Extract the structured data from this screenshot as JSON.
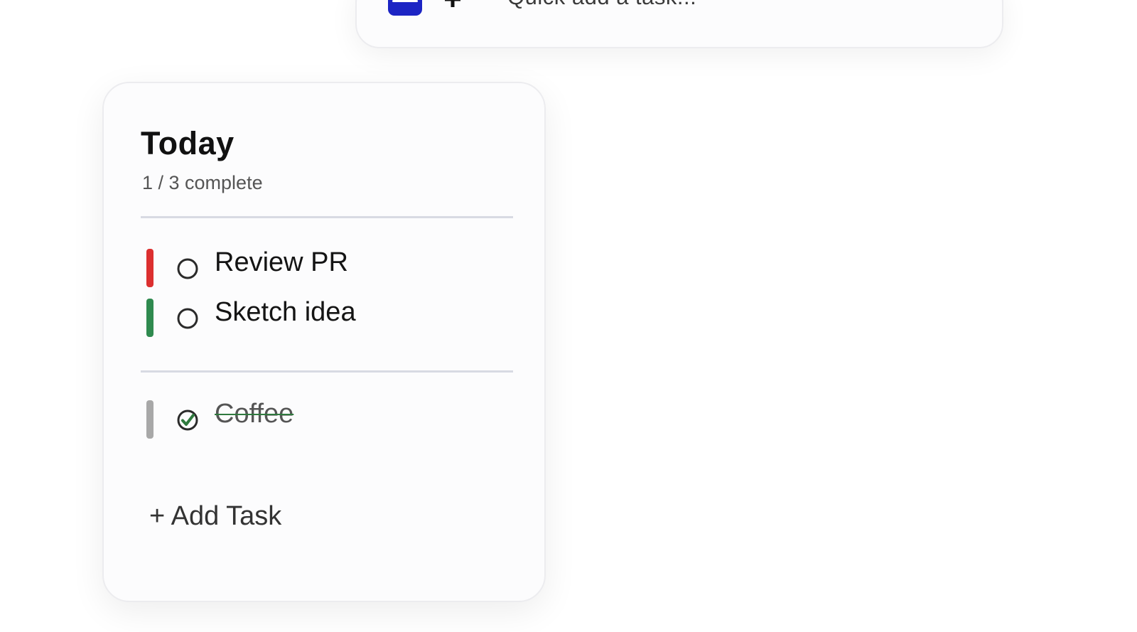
{
  "quick_add": {
    "badge_icon": "app-badge-icon",
    "plus_icon": "plus-icon",
    "placeholder": "Quick add a task..."
  },
  "today": {
    "title": "Today",
    "progress": "1 / 3 complete",
    "tasks": [
      {
        "label": "Review PR",
        "priority_color": "#dc2f2f",
        "done": false
      },
      {
        "label": "Sketch idea",
        "priority_color": "#2f8a4f",
        "done": false
      }
    ],
    "completed": [
      {
        "label": "Coffee",
        "priority_color": "#a8a8a8",
        "done": true
      }
    ],
    "add_task_label": "+ Add Task"
  },
  "colors": {
    "accent_badge": "#1c24c4",
    "check_done": "#2f7a3e",
    "divider": "#d8dae3"
  }
}
